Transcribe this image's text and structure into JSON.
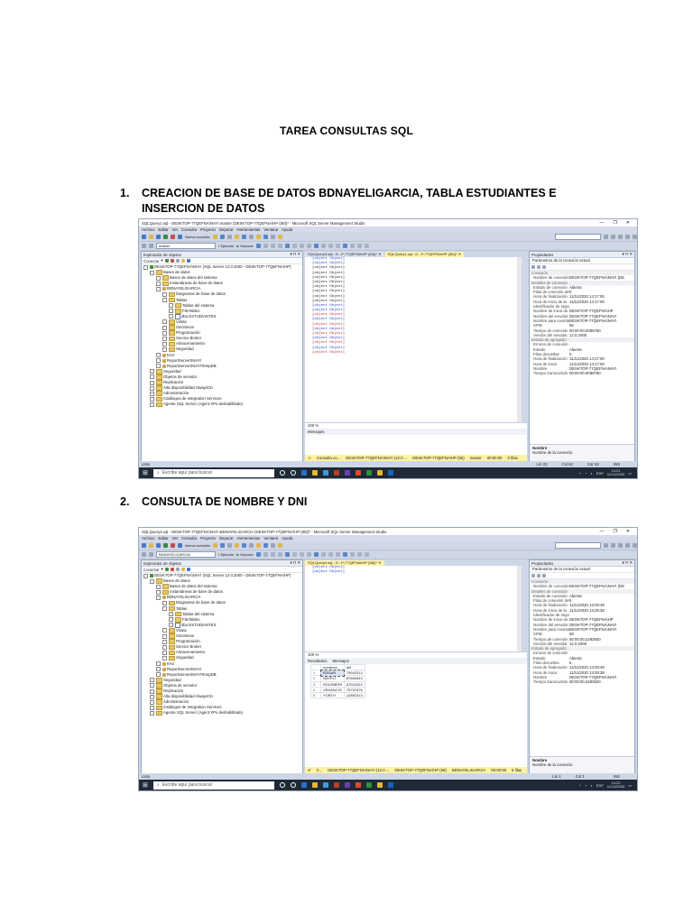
{
  "document": {
    "title": "TAREA CONSULTAS SQL",
    "section1": {
      "number": "1.",
      "heading": "CREACION DE BASE DE DATOS  BDNAYELIGARCIA, TABLA ESTUDIANTES E INSERCION DE DATOS"
    },
    "section2": {
      "number": "2.",
      "heading": "CONSULTA DE NOMBRE Y DNI"
    }
  },
  "screenshot1": {
    "window_title": "SQLQuery1.sql - DESKTOP-77QEFNA\\NAYI.master (DESKTOP-77QEFNA\\HP (56))* - Microsoft SQL Server Management Studio",
    "menu": [
      "Archivo",
      "Editar",
      "Ver",
      "Consulta",
      "Proyecto",
      "Depurar",
      "Herramientas",
      "Ventana",
      "Ayuda"
    ],
    "toolbar_new_query": "Nueva consulta",
    "toolbar_db": "master",
    "toolbar_execute": "Ejecutar",
    "toolbar_debug": "Depurar",
    "object_explorer": {
      "title": "Explorador de objetos",
      "connect": "Conectar",
      "items": [
        {
          "label": "DESKTOP-77QEFNA\\NAYI (SQL Server 12.0.2000 - DESKTOP-77QEFNA\\HP)",
          "indent": 0,
          "icon": "server"
        },
        {
          "label": "Bases de datos",
          "indent": 1,
          "icon": "folder"
        },
        {
          "label": "Bases de datos del sistema",
          "indent": 2,
          "icon": "folder"
        },
        {
          "label": "Instantáneas de base de datos",
          "indent": 2,
          "icon": "folder"
        },
        {
          "label": "BDNAYELIGARCIA",
          "indent": 2,
          "icon": "db"
        },
        {
          "label": "Diagramas de base de datos",
          "indent": 3,
          "icon": "folder"
        },
        {
          "label": "Tablas",
          "indent": 3,
          "icon": "folder"
        },
        {
          "label": "Tablas del sistema",
          "indent": 4,
          "icon": "folder"
        },
        {
          "label": "FileTables",
          "indent": 4,
          "icon": "folder"
        },
        {
          "label": "dbo.ESTUDIANTES",
          "indent": 4,
          "icon": "table"
        },
        {
          "label": "Vistas",
          "indent": 3,
          "icon": "folder"
        },
        {
          "label": "Sinónimos",
          "indent": 3,
          "icon": "folder"
        },
        {
          "label": "Programación",
          "indent": 3,
          "icon": "folder"
        },
        {
          "label": "Service Broker",
          "indent": 3,
          "icon": "folder"
        },
        {
          "label": "Almacenamiento",
          "indent": 3,
          "icon": "folder"
        },
        {
          "label": "Seguridad",
          "indent": 3,
          "icon": "folder"
        },
        {
          "label": "KHJ",
          "indent": 2,
          "icon": "db"
        },
        {
          "label": "ReportServerSNAYI",
          "indent": 2,
          "icon": "db"
        },
        {
          "label": "ReportServerSNAYITempDB",
          "indent": 2,
          "icon": "db"
        },
        {
          "label": "Seguridad",
          "indent": 1,
          "icon": "folder"
        },
        {
          "label": "Objetos de servidor",
          "indent": 1,
          "icon": "folder"
        },
        {
          "label": "Replicación",
          "indent": 1,
          "icon": "folder"
        },
        {
          "label": "Alta disponibilidad AlwaysOn",
          "indent": 1,
          "icon": "folder"
        },
        {
          "label": "Administración",
          "indent": 1,
          "icon": "folder"
        },
        {
          "label": "Catálogos de Integration Services",
          "indent": 1,
          "icon": "folder"
        },
        {
          "label": "Agente SQL Server (Agent XPs deshabilitado)",
          "indent": 1,
          "icon": "folder"
        }
      ]
    },
    "tabs": [
      "SQLQuery3.sql - D...P-77QEFNA\\HP (60))*",
      "SQLQuery1.sql - D...P-77QEFNA\\HP (56))*"
    ],
    "code": [
      {
        "t": "CREATE DATABASE BDNAYELIGARCIA",
        "c": "kw"
      },
      {
        "t": "CREATE TABLE ESTUDIANTES",
        "c": "kw"
      },
      {
        "t": "(",
        "c": ""
      },
      {
        "t": "cod_estudiante int PRIMARY KEY IDENTITY,",
        "c": ""
      },
      {
        "t": "Nombres nchar(20),",
        "c": ""
      },
      {
        "t": "Apellidos nchar(30) NOT NULL,",
        "c": ""
      },
      {
        "t": "DNI nchar(10) NOT NULL,",
        "c": ""
      },
      {
        "t": "edad nchar(10) NOT NULL,",
        "c": ""
      },
      {
        "t": "Direccion nchar(40) NOT NULL",
        "c": ""
      },
      {
        "t": ")",
        "c": ""
      },
      {
        "t": "GO",
        "c": "kw"
      },
      {
        "t": "INSERT INTO ESTUDIANTES",
        "c": "kw"
      },
      {
        "t": "VALUES ('EDGAR','perez paco','75951321','20','av. San Simon')",
        "c": "str"
      },
      {
        "t": "INSERT INTO ESTUDIANTES",
        "c": "kw"
      },
      {
        "t": "VALUES ('NAYELI','rodas garcia','71831256','22','jr. paucartambo')",
        "c": "str"
      },
      {
        "t": "INSERT INTO ESTUDIANTES",
        "c": "kw"
      },
      {
        "t": "VALUES ('ROUSBERI','antonio romero','71831956','19','psj. los chocheros')",
        "c": "str"
      },
      {
        "t": "INSERT INTO ESTUDIANTES",
        "c": "kw"
      },
      {
        "t": "VALUES ('VENANCIO','cantu perez','75951125','20','av. brasil')",
        "c": "str"
      },
      {
        "t": "INSERT INTO ESTUDIANTES",
        "c": "kw"
      },
      {
        "t": "VALUES ('YOROY','casa valenzuela','75951945','35','jr. marical')",
        "c": "str"
      }
    ],
    "zoom": "100 %",
    "messages_tab": "Mensajes",
    "status_left": "Consulta co...",
    "status_server": "DESKTOP-77QEFNA\\NAYI (12.0 ...",
    "status_user": "DESKTOP-77QEFNA\\HP (56)",
    "status_db": "master",
    "status_time": "00:00:00",
    "status_rows": "0 filas",
    "properties": {
      "title": "Propiedades",
      "header": "Parámetros de la conexión actual",
      "rows": [
        {
          "cat": "Conexión"
        },
        {
          "k": "Nombre de conexión",
          "v": "DESKTOP-77QEFNA\\NAYI (DE"
        },
        {
          "cat": "Detalles de conexión"
        },
        {
          "k": "Estado de conexión",
          "v": "Abierta"
        },
        {
          "k": "Filas de conexión dev.",
          "v": "0"
        },
        {
          "k": "Hora de finalización",
          "v": "11/11/2020 14:17:00"
        },
        {
          "k": "Hora de inicio de la",
          "v": "11/11/2020 14:17:00"
        },
        {
          "k": "Identificador de seguí",
          "v": ""
        },
        {
          "k": "Nombre de inicio de",
          "v": "DESKTOP-77QEFNA\\HP"
        },
        {
          "k": "Nombre del servidor",
          "v": "DESKTOP-77QEFNA\\NAYI"
        },
        {
          "k": "Nombre para mostrar",
          "v": "DESKTOP-77QEFNA\\NAYI"
        },
        {
          "k": "SPID",
          "v": "56"
        },
        {
          "k": "Tiempo de conexión",
          "v": "00:00:00.0089780"
        },
        {
          "k": "Versión del servidor",
          "v": "12.0.2000"
        },
        {
          "cat": "Estado de agregado"
        },
        {
          "k": "Errores de conexión",
          "v": ""
        },
        {
          "k": "Estado",
          "v": "Abierta"
        },
        {
          "k": "Filas devueltas",
          "v": "0"
        },
        {
          "k": "Hora de finalización",
          "v": "11/11/2020 14:17:00"
        },
        {
          "k": "Hora de inicio",
          "v": "11/11/2020 14:17:00"
        },
        {
          "k": "Nombre",
          "v": "DESKTOP-77QEFNA\\NAYI"
        },
        {
          "k": "Tiempo transcurrido",
          "v": "00:00:00.0089780"
        }
      ],
      "footer_title": "Nombre",
      "footer_text": "Nombre de la conexión."
    },
    "statusbar_left": "Listo",
    "statusbar_ln": "Lín 22",
    "statusbar_col": "Col 62",
    "statusbar_car": "Car 62",
    "statusbar_ins": "INS",
    "taskbar_search": "Escribe aquí para buscar",
    "clock_time": "14:21",
    "clock_date": "11/11/2020",
    "lang": "ESP"
  },
  "screenshot2": {
    "window_title": "SQLQuery4.sql - DESKTOP-77QEFNA\\NAYI.BDNAYELIGARCIA (DESKTOP-77QEFNA\\HP (58))* - Microsoft SQL Server Management Studio",
    "menu": [
      "Archivo",
      "Editar",
      "Ver",
      "Consulta",
      "Proyecto",
      "Depurar",
      "Herramientas",
      "Ventana",
      "Ayuda"
    ],
    "toolbar_new_query": "Nueva consulta",
    "toolbar_db": "BDNAYELIGARCIA",
    "toolbar_execute": "Ejecutar",
    "toolbar_debug": "Depurar",
    "object_explorer": {
      "title": "Explorador de objetos",
      "connect": "Conectar",
      "items": [
        {
          "label": "DESKTOP-77QEFNA\\NAYI (SQL Server 12.0.2000 - DESKTOP-77QEFNA\\HP)",
          "indent": 0,
          "icon": "server"
        },
        {
          "label": "Bases de datos",
          "indent": 1,
          "icon": "folder"
        },
        {
          "label": "Bases de datos del sistema",
          "indent": 2,
          "icon": "folder"
        },
        {
          "label": "Instantáneas de base de datos",
          "indent": 2,
          "icon": "folder"
        },
        {
          "label": "BDNAYELIGARCIA",
          "indent": 2,
          "icon": "db"
        },
        {
          "label": "Diagramas de base de datos",
          "indent": 3,
          "icon": "folder"
        },
        {
          "label": "Tablas",
          "indent": 3,
          "icon": "folder"
        },
        {
          "label": "Tablas del sistema",
          "indent": 4,
          "icon": "folder"
        },
        {
          "label": "FileTables",
          "indent": 4,
          "icon": "folder"
        },
        {
          "label": "dbo.ESTUDIANTES",
          "indent": 4,
          "icon": "table"
        },
        {
          "label": "Vistas",
          "indent": 3,
          "icon": "folder"
        },
        {
          "label": "Sinónimos",
          "indent": 3,
          "icon": "folder"
        },
        {
          "label": "Programación",
          "indent": 3,
          "icon": "folder"
        },
        {
          "label": "Service Broker",
          "indent": 3,
          "icon": "folder"
        },
        {
          "label": "Almacenamiento",
          "indent": 3,
          "icon": "folder"
        },
        {
          "label": "Seguridad",
          "indent": 3,
          "icon": "folder"
        },
        {
          "label": "KHJ",
          "indent": 2,
          "icon": "db"
        },
        {
          "label": "ReportServerSNAYI",
          "indent": 2,
          "icon": "db"
        },
        {
          "label": "ReportServerSNAYITempDB",
          "indent": 2,
          "icon": "db"
        },
        {
          "label": "Seguridad",
          "indent": 1,
          "icon": "folder"
        },
        {
          "label": "Objetos de servidor",
          "indent": 1,
          "icon": "folder"
        },
        {
          "label": "Replicación",
          "indent": 1,
          "icon": "folder"
        },
        {
          "label": "Alta disponibilidad AlwaysOn",
          "indent": 1,
          "icon": "folder"
        },
        {
          "label": "Administración",
          "indent": 1,
          "icon": "folder"
        },
        {
          "label": "Catálogos de Integration Services",
          "indent": 1,
          "icon": "folder"
        },
        {
          "label": "Agente SQL Server (Agent XPs deshabilitado)",
          "indent": 1,
          "icon": "folder"
        }
      ]
    },
    "tabs": [
      "SQLQuery4.sql - D...P-77QEFNA\\HP (58))*"
    ],
    "code": [
      {
        "t": "SELECT DISTINCT nombres, dni",
        "c": "kw"
      },
      {
        "t": "from  ESTUDIANTES",
        "c": "kw"
      }
    ],
    "zoom": "100 %",
    "results_tab": "Resultados",
    "messages_tab": "Mensajes",
    "result_columns": [
      "nombres",
      "dni"
    ],
    "result_rows": [
      [
        "1",
        "EDGAR",
        "75942312"
      ],
      [
        "2",
        "NAYELI",
        "87654543"
      ],
      [
        "3",
        "ROUSBERI",
        "87524321"
      ],
      [
        "4",
        "VENANCIO",
        "75757676"
      ],
      [
        "5",
        "YOROY",
        "12892313"
      ]
    ],
    "status_left": "C...",
    "status_server": "DESKTOP-77QEFNA\\NAYI (12.0 ...",
    "status_user": "DESKTOP-77QEFNA\\HP (58)",
    "status_db": "BDNAYELIGARCIA",
    "status_time": "00:00:00",
    "status_rows": "5 filas",
    "properties": {
      "title": "Propiedades",
      "header": "Parámetros de la conexión actual",
      "rows": [
        {
          "cat": "Conexión"
        },
        {
          "k": "Nombre de conexión",
          "v": "DESKTOP-77QEFNA\\NAYI (DE"
        },
        {
          "cat": "Detalles de conexión"
        },
        {
          "k": "Estado de conexión",
          "v": "Abierta"
        },
        {
          "k": "Filas de conexión dev.",
          "v": "5"
        },
        {
          "k": "Hora de finalización",
          "v": "11/11/2020 13:29:48"
        },
        {
          "k": "Hora de inicio de la",
          "v": "11/11/2020 13:29:38"
        },
        {
          "k": "Identificador de seguí",
          "v": ""
        },
        {
          "k": "Nombre de inicio de",
          "v": "DESKTOP-77QEFNA\\HP"
        },
        {
          "k": "Nombre del servidor",
          "v": "DESKTOP-77QEFNA\\NAYI"
        },
        {
          "k": "Nombre para mostrar",
          "v": "DESKTOP-77QEFNA\\NAYI"
        },
        {
          "k": "SPID",
          "v": "58"
        },
        {
          "k": "Tiempo de conexión",
          "v": "00:00:00.2282820"
        },
        {
          "k": "Versión del servidor",
          "v": "12.0.2000"
        },
        {
          "cat": "Estado de agregado"
        },
        {
          "k": "Errores de conexión",
          "v": ""
        },
        {
          "k": "Estado",
          "v": "Abierta"
        },
        {
          "k": "Filas devueltas",
          "v": "5"
        },
        {
          "k": "Hora de finalización",
          "v": "11/11/2020 13:29:48"
        },
        {
          "k": "Hora de inicio",
          "v": "11/11/2020 13:29:38"
        },
        {
          "k": "Nombre",
          "v": "DESKTOP-77QEFNA\\NAYI"
        },
        {
          "k": "Tiempo transcurrido",
          "v": "00:00:00.2282820"
        }
      ],
      "footer_title": "Nombre",
      "footer_text": "Nombre de la conexión."
    },
    "statusbar_left": "Listo",
    "statusbar_ln": "Lín 1",
    "statusbar_col": "Col 1",
    "statusbar_car": "",
    "statusbar_ins": "INS",
    "taskbar_search": "Escribe aquí para buscar",
    "clock_time": "14:22",
    "clock_date": "11/11/2020",
    "lang": "ESP"
  }
}
